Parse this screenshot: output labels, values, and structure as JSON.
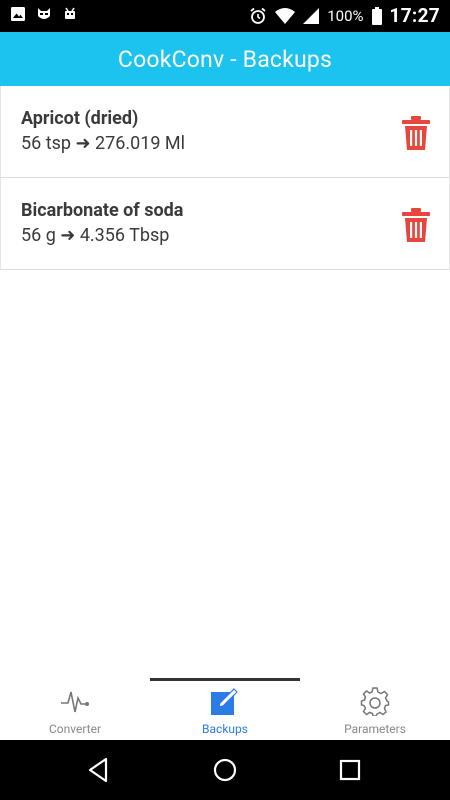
{
  "status_bar": {
    "battery_percent": "100%",
    "time": "17:27",
    "icons": [
      "image-icon",
      "cat-mask-icon",
      "android-icon",
      "alarm-icon",
      "wifi-icon",
      "signal-icon",
      "battery-icon"
    ]
  },
  "app_bar": {
    "title": "CookConv - Backups"
  },
  "backups": [
    {
      "name": "Apricot (dried)",
      "conversion": "56 tsp ➜ 276.019 Ml"
    },
    {
      "name": "Bicarbonate of soda",
      "conversion": "56 g ➜ 4.356 Tbsp"
    }
  ],
  "tabs": [
    {
      "label": "Converter",
      "icon": "pulse-icon",
      "active": false
    },
    {
      "label": "Backups",
      "icon": "edit-icon",
      "active": true
    },
    {
      "label": "Parameters",
      "icon": "gear-icon",
      "active": false
    }
  ],
  "colors": {
    "app_bar": "#1bc3ee",
    "delete": "#e8453c",
    "active_tab": "#2d7be5",
    "inactive_tab": "#888888"
  },
  "nav_bar": {
    "buttons": [
      "back-button",
      "home-button",
      "recents-button"
    ]
  }
}
